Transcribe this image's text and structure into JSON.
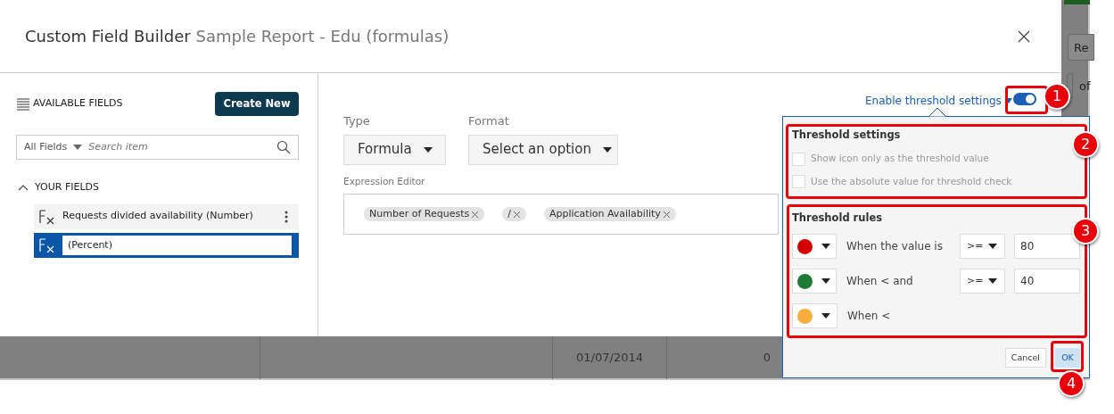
{
  "dialog": {
    "title": "Custom Field Builder",
    "subtitle": "Sample Report - Edu (formulas)"
  },
  "fields_panel": {
    "heading": "AVAILABLE FIELDS",
    "create_button": "Create New",
    "filter": "All Fields",
    "search": {
      "placeholder": "Search item"
    },
    "section": {
      "label": "YOUR FIELDS",
      "expanded": true
    },
    "items": [
      {
        "kind": "item",
        "label": "Requests divided availability (Number)",
        "selected": false
      },
      {
        "kind": "edit",
        "value": "(Percent)",
        "selected": true
      }
    ]
  },
  "editor": {
    "type_label": "Type",
    "type_value": "Formula",
    "format_label": "Format",
    "format_value": "Select an option",
    "expression_label": "Expression Editor",
    "tokens": [
      "Number of Requests",
      "/",
      "Application Availability"
    ]
  },
  "threshold": {
    "link": "Enable threshold settings",
    "enabled": true,
    "settings_title": "Threshold settings",
    "options": [
      {
        "label": "Show icon only as the threshold value",
        "checked": false,
        "disabled": true
      },
      {
        "label": "Use the absolute value for threshold check",
        "checked": false,
        "disabled": true
      }
    ],
    "rules_title": "Threshold rules",
    "rules": [
      {
        "color": "#d40000",
        "label": "When the value is",
        "operator": ">=",
        "value": "80"
      },
      {
        "color": "#1e7a34",
        "label": "When < and",
        "operator": ">=",
        "value": "40"
      },
      {
        "color": "#f8ac3b",
        "label": "When <"
      }
    ],
    "buttons": {
      "cancel": "Cancel",
      "ok": "OK"
    }
  },
  "background": {
    "cells": [
      "01/07/2014",
      "0"
    ],
    "side_button": "Re",
    "side_text": "of"
  },
  "callouts": [
    "1",
    "2",
    "3",
    "4"
  ]
}
